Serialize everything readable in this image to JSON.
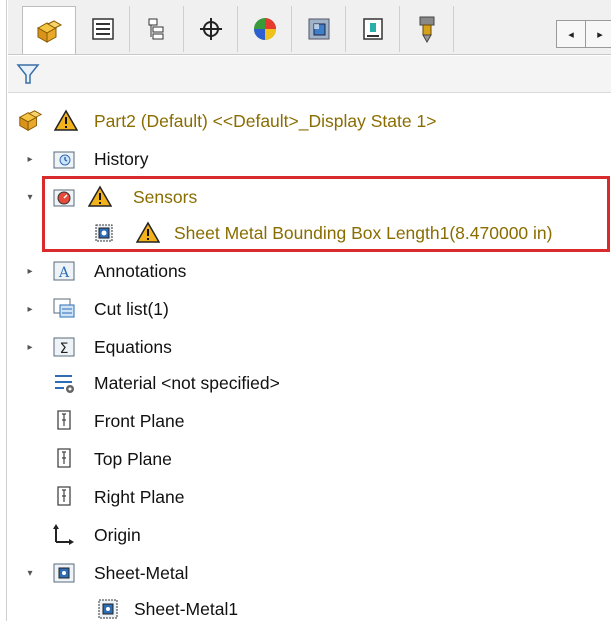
{
  "tabs": [
    {
      "id": "feature-manager",
      "icon": "part-cubes-icon"
    },
    {
      "id": "property-manager",
      "icon": "property-manager-icon"
    },
    {
      "id": "configuration-manager",
      "icon": "configuration-manager-icon"
    },
    {
      "id": "dimxpert-manager",
      "icon": "crosshair-icon"
    },
    {
      "id": "display-manager",
      "icon": "display-manager-icon"
    },
    {
      "id": "cam-manager",
      "icon": "cube-view-icon"
    },
    {
      "id": "sheet-metal-manager",
      "icon": "press-tool-icon"
    },
    {
      "id": "cam-tool",
      "icon": "mill-tool-icon"
    }
  ],
  "scroll": {
    "left": "◂",
    "right": "▸"
  },
  "tree": {
    "root": {
      "label": "Part2 (Default) <<Default>_Display State 1>"
    },
    "items": [
      {
        "label": "History"
      },
      {
        "label": "Sensors"
      },
      {
        "label": "Sheet Metal Bounding Box Length1(8.470000 in)"
      },
      {
        "label": "Annotations"
      },
      {
        "label": "Cut list(1)"
      },
      {
        "label": "Equations"
      },
      {
        "label": "Material <not specified>"
      },
      {
        "label": "Front Plane"
      },
      {
        "label": "Top Plane"
      },
      {
        "label": "Right Plane"
      },
      {
        "label": "Origin"
      },
      {
        "label": "Sheet-Metal"
      },
      {
        "label": "Sheet-Metal1"
      }
    ]
  },
  "colors": {
    "warning": "#8a6d00",
    "highlight": "#d92b2b",
    "accent": "#f2b21b"
  }
}
